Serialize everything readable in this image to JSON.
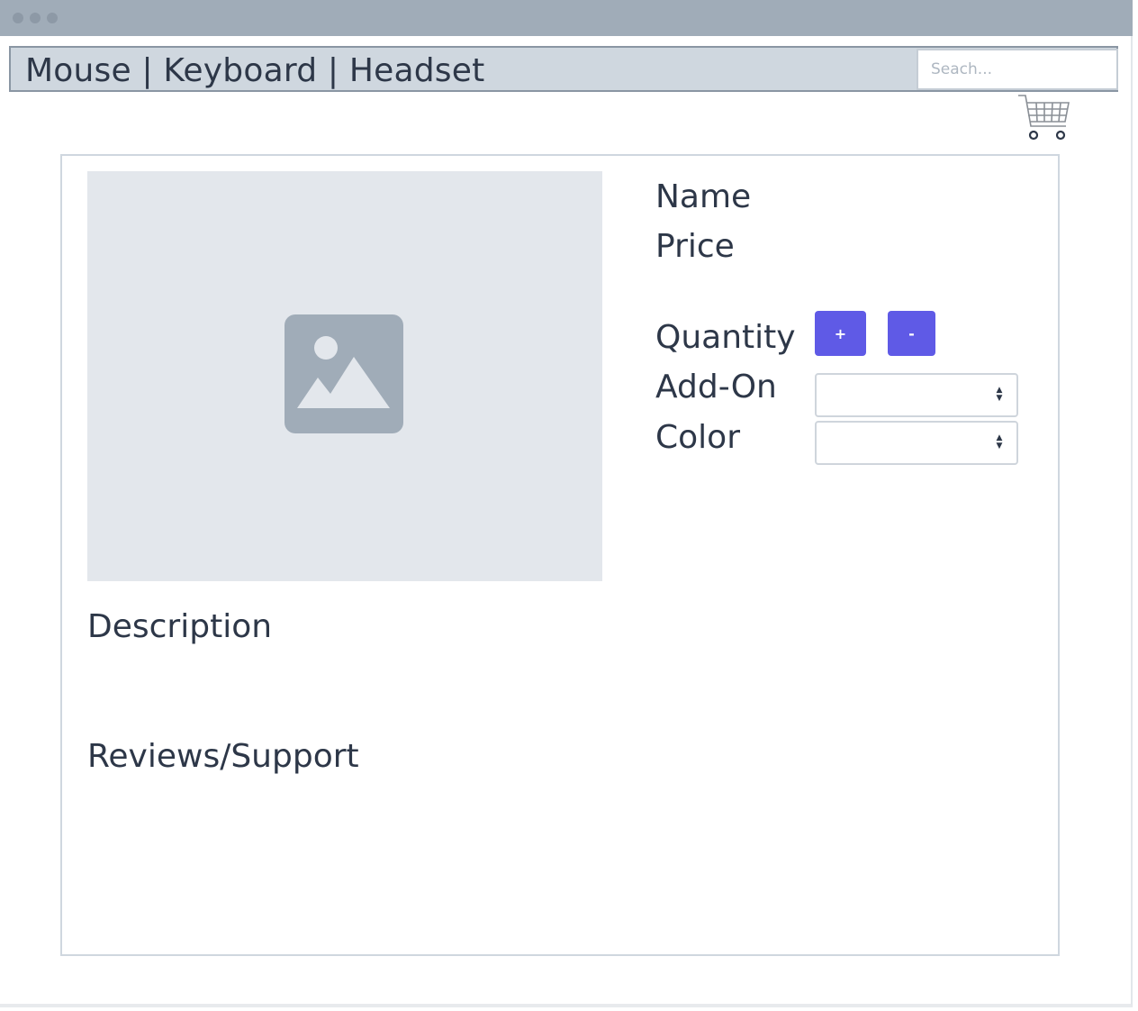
{
  "nav": {
    "links": "Mouse | Keyboard | Headset",
    "search_placeholder": "Seach..."
  },
  "product": {
    "name_label": "Name",
    "price_label": "Price",
    "quantity_label": "Quantity",
    "increment_label": "+",
    "decrement_label": "-",
    "addon_label": "Add-On",
    "color_label": "Color",
    "description_label": "Description",
    "reviews_label": "Reviews/Support"
  },
  "icons": {
    "window_controls": "window-dot-icon",
    "cart": "shopping-cart-icon",
    "image_placeholder": "image-icon",
    "select_arrows": "select-arrows-icon"
  },
  "colors": {
    "titlebar": "#a0acb8",
    "navbar": "#cfd7df",
    "accent_button": "#5f5ae6",
    "text": "#2d3748",
    "placeholder_bg": "#e3e7ec"
  }
}
